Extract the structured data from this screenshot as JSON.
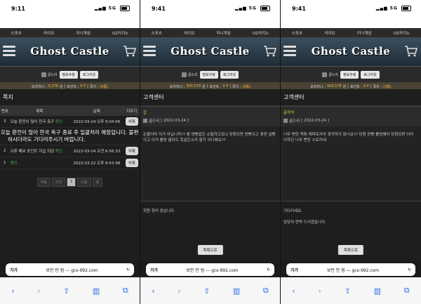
{
  "screens": [
    {
      "time": "9:11",
      "network": "5G",
      "nav": [
        "스포츠",
        "라이브",
        "미니게임",
        "OZ카지노"
      ],
      "logo": "Ghost Castle",
      "user": {
        "nick": "골드리",
        "btn_info": "정보수정",
        "btn_logout": "로그아웃"
      },
      "points": {
        "balance_label": "보유머니 :",
        "balance": "5,578",
        "balance_unit": "원",
        "point_label": "포인트 :",
        "point": "0 P",
        "note_label": "쪽지 :",
        "note": "(0통)"
      },
      "page_title": "쪽지",
      "table": {
        "headers": [
          "번호",
          "제목",
          "날짜",
          "지우기"
        ],
        "rows": [
          {
            "num": "3",
            "title": "오늘 환전이 많아 한국 축구",
            "tag": "확인",
            "date": "2022-03-24 오후 9:04:56",
            "del": "삭제"
          },
          {
            "num": "2",
            "title": "오류 패보 포인트 지급 되었",
            "tag": "확인",
            "date": "2022-03-24 오전 6:56:33",
            "del": "삭제"
          },
          {
            "num": "1",
            "title": "",
            "tag": "확인",
            "date": "2022-03-22 오후 8:43:48",
            "del": "삭제"
          }
        ],
        "message_line1": "오늘 환전이 많아 한국 축구 종료 후 일괄처리 예정입니다. 불편",
        "message_line2": "하시더라도 기다려주시기 바랍니다."
      },
      "pager": [
        "처음",
        "이전",
        "1",
        "다음",
        "끝"
      ],
      "url": "보안 안 됨 — gcs-992.com",
      "aa": "가가"
    },
    {
      "time": "9:41",
      "network": "5G",
      "nav": [
        "스포츠",
        "라이브",
        "미니게임",
        "OZ카지노"
      ],
      "logo": "Ghost Castle",
      "user": {
        "nick": "골드리",
        "btn_info": "정보수정",
        "btn_logout": "로그아웃"
      },
      "points": {
        "balance_label": "보유머니 :",
        "balance": "505,578",
        "balance_unit": "원",
        "point_label": "포인트 :",
        "point": "0 P",
        "note_label": "쪽지 :",
        "note": "(0통)"
      },
      "page_title": "고객센터",
      "post": {
        "category": "갑",
        "author": "골드리",
        "date": "[ 2022-03-24 ]",
        "body": "돈줄어라 이거 아닙니까?? 왜 양빵같은 소릴하고있냐 당첨되면 양빵이고 꽃연 실빵이고 이거 롤링 올려도 똑같은소리 할거 아니에요??",
        "reply": "회원 정리 중입니다."
      },
      "list_button": "목록으로",
      "url": "보안 안 됨 — gcs-992.com",
      "aa": "가가"
    },
    {
      "time": "9:41",
      "network": "5G",
      "nav": [
        "스포츠",
        "라이브",
        "미니게임",
        "OZ카지노"
      ],
      "logo": "Ghost Castle",
      "user": {
        "nick": "골드리",
        "btn_info": "정보수정",
        "btn_logout": "로그아웃"
      },
      "points": {
        "balance_label": "보유머니 :",
        "balance": "505,578",
        "balance_unit": "원",
        "point_label": "포인트 :",
        "point": "0 P",
        "note_label": "쪽지 :",
        "note": "(0통)"
      },
      "page_title": "고객센터",
      "post": {
        "category": "출작처",
        "author": "골드리",
        "date": "[ 2022-03-24 ]",
        "body": "너무 뻔한 먹튀 레파토리라 생각하지 않나요?? 당첨 양빵 롤링해라 당첨되면 이러 다하던 너무 뻔한 스토리네",
        "reply": "기다리세요.\n\n담당자 연락 드리겠습니다."
      },
      "list_button": "목록으로",
      "url": "보안 안 됨 — gcs-992.com",
      "aa": "가가"
    }
  ]
}
